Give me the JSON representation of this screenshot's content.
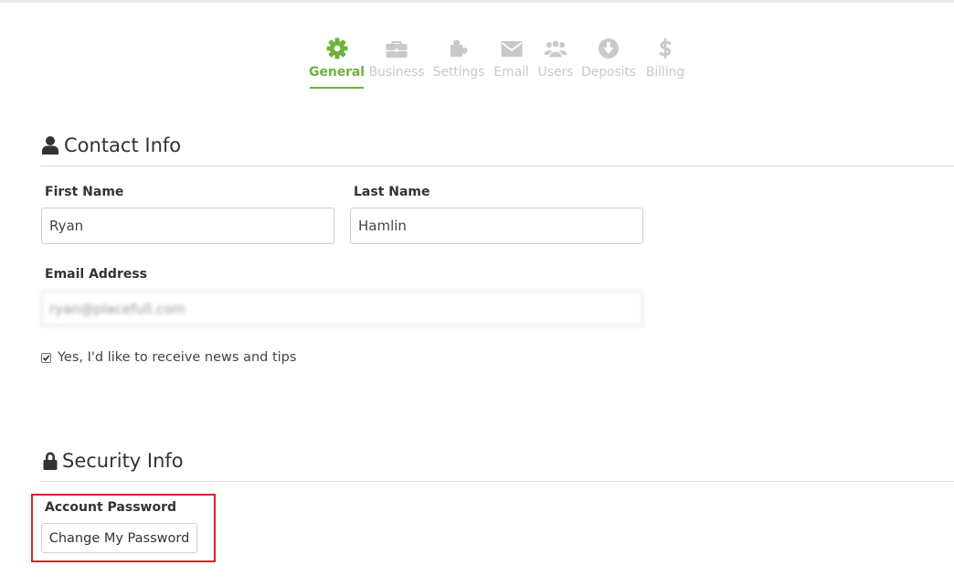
{
  "tabs": [
    {
      "label": "General",
      "icon": "gear-icon",
      "active": true
    },
    {
      "label": "Business",
      "icon": "briefcase-icon",
      "active": false
    },
    {
      "label": "Settings",
      "icon": "puzzle-icon",
      "active": false
    },
    {
      "label": "Email",
      "icon": "envelope-icon",
      "active": false
    },
    {
      "label": "Users",
      "icon": "users-icon",
      "active": false
    },
    {
      "label": "Deposits",
      "icon": "arrow-circle-down-icon",
      "active": false
    },
    {
      "label": "Billing",
      "icon": "dollar-icon",
      "active": false
    }
  ],
  "colors": {
    "accent": "#6cb33e",
    "inactive_tab": "#c9c9c9",
    "highlight": "#d9252a"
  },
  "contact": {
    "title": "Contact Info",
    "first_name_label": "First Name",
    "first_name_value": "Ryan",
    "last_name_label": "Last Name",
    "last_name_value": "Hamlin",
    "email_label": "Email Address",
    "email_value": "ryan@placefull.com",
    "newsletter_label": "Yes, I'd like to receive news and tips",
    "newsletter_checked": true
  },
  "security": {
    "title": "Security Info",
    "password_label": "Account Password",
    "change_password_button": "Change My Password"
  }
}
